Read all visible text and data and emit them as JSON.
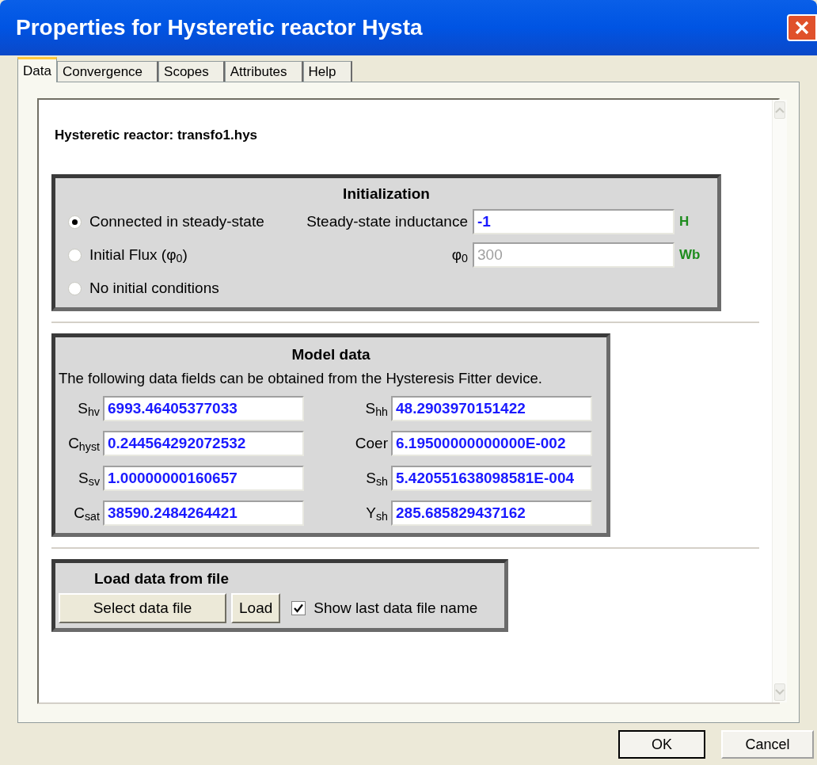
{
  "window": {
    "title": "Properties for Hysteretic reactor Hysta"
  },
  "tabs": [
    {
      "label": "Data",
      "selected": true
    },
    {
      "label": "Convergence",
      "selected": false
    },
    {
      "label": "Scopes",
      "selected": false
    },
    {
      "label": "Attributes",
      "selected": false
    },
    {
      "label": "Help",
      "selected": false
    }
  ],
  "heading": "Hysteretic reactor: transfo1.hys",
  "initialization": {
    "title": "Initialization",
    "options": [
      {
        "label": "Connected in steady-state",
        "selected": true
      },
      {
        "label": "Initial Flux (φ$_{0}$)",
        "selected": false
      },
      {
        "label": "No initial conditions",
        "selected": false
      }
    ],
    "fields": [
      {
        "label": "Steady-state inductance",
        "value": "-1",
        "unit": "H",
        "disabled": false
      },
      {
        "label": "φ$_{0}$",
        "value": "300",
        "unit": "Wb",
        "disabled": true
      }
    ]
  },
  "model_data": {
    "title": "Model data",
    "note": "The following data fields can be obtained from the Hysteresis Fitter device.",
    "fields": [
      {
        "label": "S$_{hv}$",
        "value": "6993.46405377033"
      },
      {
        "label": "S$_{hh}$",
        "value": "48.2903970151422"
      },
      {
        "label": "C$_{hyst}$",
        "value": "0.244564292072532"
      },
      {
        "label": "Coer",
        "value": "6.19500000000000E-002"
      },
      {
        "label": "S$_{sv}$",
        "value": "1.00000000160657"
      },
      {
        "label": "S$_{sh}$",
        "value": "5.420551638098581E-004"
      },
      {
        "label": "C$_{sat}$",
        "value": "38590.2484264421"
      },
      {
        "label": "Y$_{sh}$",
        "value": "285.685829437162"
      }
    ]
  },
  "load": {
    "title": "Load data from file",
    "buttons": [
      "Select data file",
      "Load"
    ],
    "checkbox": {
      "label": "Show last data file name",
      "checked": true
    }
  },
  "buttons": [
    {
      "label": "OK",
      "default": true
    },
    {
      "label": "Cancel",
      "default": false
    }
  ]
}
